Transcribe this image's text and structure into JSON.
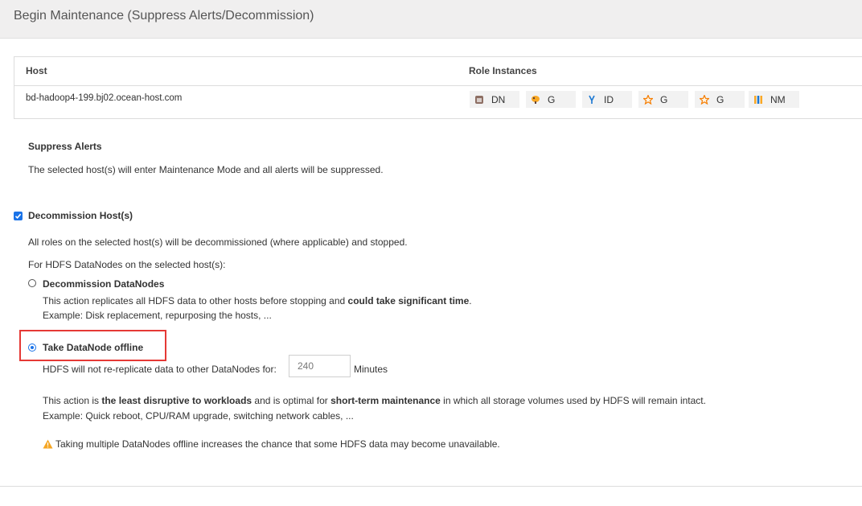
{
  "header": {
    "title": "Begin Maintenance (Suppress Alerts/Decommission)"
  },
  "table": {
    "columns": [
      "Host",
      "Role Instances"
    ],
    "host": "bd-hadoop4-199.bj02.ocean-host.com",
    "roles": [
      {
        "label": "DN",
        "icon": "datanode-icon",
        "color": "#8d6e63"
      },
      {
        "label": "G",
        "icon": "gateway-hive-icon",
        "color": "#f9a825"
      },
      {
        "label": "ID",
        "icon": "impala-daemon-icon",
        "color": "#1976d2"
      },
      {
        "label": "G",
        "icon": "gateway-star-icon",
        "color": "#f57c00"
      },
      {
        "label": "G",
        "icon": "gateway-star-icon",
        "color": "#f57c00"
      },
      {
        "label": "NM",
        "icon": "nodemanager-icon",
        "color": "#f9a825"
      }
    ]
  },
  "suppress": {
    "heading": "Suppress Alerts",
    "text": "The selected host(s) will enter Maintenance Mode and all alerts will be suppressed."
  },
  "decommission": {
    "label": "Decommission Host(s)",
    "checked": true,
    "desc": "All roles on the selected host(s) will be decommissioned (where applicable) and stopped.",
    "hdfs_label": "For HDFS DataNodes on the selected host(s):",
    "option1": {
      "label": "Decommission DataNodes",
      "line1_pre": "This action replicates all HDFS data to other hosts before stopping and ",
      "line1_bold": "could take significant time",
      "line1_post": ".",
      "example": "Example: Disk replacement, repurposing the hosts, ..."
    },
    "option2": {
      "label": "Take DataNode offline",
      "selected": true,
      "minutes_pre": "HDFS will not re-replicate data to other DataNodes for:",
      "minutes_value": "240",
      "minutes_unit": "Minutes",
      "desc_a": "This action is ",
      "desc_b": "the least disruptive to workloads",
      "desc_c": " and is optimal for ",
      "desc_d": "short-term maintenance",
      "desc_e": " in which all storage volumes used by HDFS will remain intact.",
      "example": "Example: Quick reboot, CPU/RAM upgrade, switching network cables, ...",
      "warning": "Taking multiple DataNodes offline increases the chance that some HDFS data may become unavailable."
    }
  },
  "colors": {
    "accent": "#1a73e8",
    "highlight": "#e53935",
    "warning": "#f5a623"
  }
}
